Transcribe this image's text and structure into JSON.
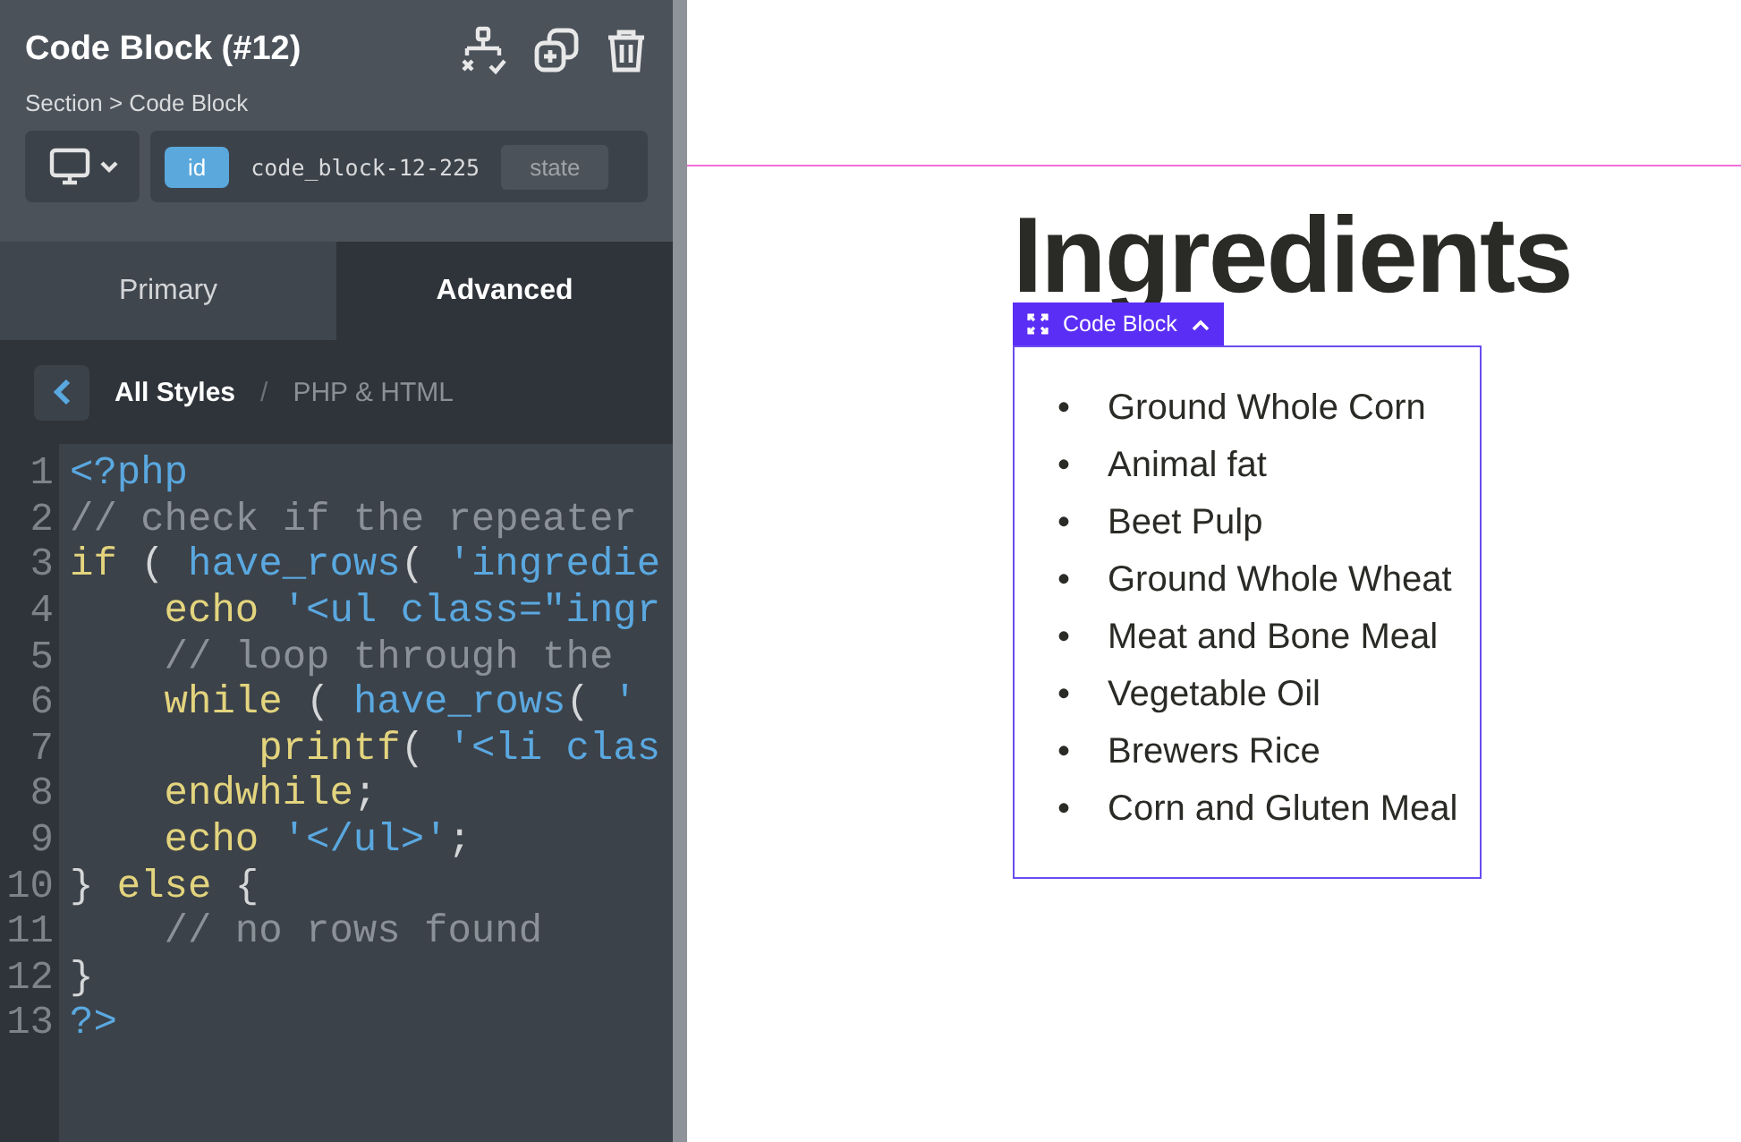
{
  "panel": {
    "title": "Code Block (#12)",
    "breadcrumb": "Section > Code Block",
    "selector": {
      "badge": "id",
      "value": "code_block-12-225",
      "state_button": "state"
    },
    "tabs": [
      {
        "label": "Primary",
        "selected": false
      },
      {
        "label": "Advanced",
        "selected": true
      }
    ],
    "style_path": {
      "current": "All Styles",
      "separator": "/",
      "section": "PHP & HTML"
    },
    "code_lines": [
      {
        "number": "1",
        "tokens": [
          {
            "kind": "tag",
            "text": "<?php"
          }
        ]
      },
      {
        "number": "2",
        "tokens": [
          {
            "kind": "comment",
            "text": "// check if the repeater"
          }
        ]
      },
      {
        "number": "3",
        "tokens": [
          {
            "kind": "keyword",
            "text": "if"
          },
          {
            "kind": "plain",
            "text": " ( "
          },
          {
            "kind": "function",
            "text": "have_rows"
          },
          {
            "kind": "plain",
            "text": "( "
          },
          {
            "kind": "string",
            "text": "'ingredie"
          }
        ]
      },
      {
        "number": "4",
        "tokens": [
          {
            "kind": "keyword",
            "text": "    echo"
          },
          {
            "kind": "string",
            "text": " '<ul class=\"ingr"
          }
        ]
      },
      {
        "number": "5",
        "tokens": [
          {
            "kind": "comment",
            "text": "    // loop through the"
          }
        ]
      },
      {
        "number": "6",
        "tokens": [
          {
            "kind": "keyword",
            "text": "    while"
          },
          {
            "kind": "plain",
            "text": " ( "
          },
          {
            "kind": "function",
            "text": "have_rows"
          },
          {
            "kind": "plain",
            "text": "( "
          },
          {
            "kind": "string",
            "text": "'"
          }
        ]
      },
      {
        "number": "7",
        "tokens": [
          {
            "kind": "keyword",
            "text": "        printf"
          },
          {
            "kind": "plain",
            "text": "( "
          },
          {
            "kind": "string",
            "text": "'<li clas"
          }
        ]
      },
      {
        "number": "8",
        "tokens": [
          {
            "kind": "keyword",
            "text": "    endwhile"
          },
          {
            "kind": "plain",
            "text": ";"
          }
        ]
      },
      {
        "number": "9",
        "tokens": [
          {
            "kind": "keyword",
            "text": "    echo"
          },
          {
            "kind": "string",
            "text": " '</ul>'"
          },
          {
            "kind": "plain",
            "text": ";"
          }
        ]
      },
      {
        "number": "10",
        "tokens": [
          {
            "kind": "plain",
            "text": "} "
          },
          {
            "kind": "keyword",
            "text": "else"
          },
          {
            "kind": "plain",
            "text": " {"
          }
        ]
      },
      {
        "number": "11",
        "tokens": [
          {
            "kind": "comment",
            "text": "    // no rows found"
          }
        ]
      },
      {
        "number": "12",
        "tokens": [
          {
            "kind": "plain",
            "text": "}"
          }
        ]
      },
      {
        "number": "13",
        "tokens": [
          {
            "kind": "tag",
            "text": "?>"
          }
        ]
      }
    ]
  },
  "canvas": {
    "heading": "Ingredients",
    "selection_label": "Code Block",
    "list": [
      {
        "marker": "•",
        "text": "Ground Whole Corn"
      },
      {
        "marker": "•",
        "text": "Animal fat"
      },
      {
        "marker": "•",
        "text": "Beet Pulp"
      },
      {
        "marker": "•",
        "text": "Ground Whole Wheat"
      },
      {
        "marker": "•",
        "text": "Meat and Bone Meal"
      },
      {
        "marker": "•",
        "text": "Vegetable Oil"
      },
      {
        "marker": "•",
        "text": "Brewers Rice"
      },
      {
        "marker": "•",
        "text": "Corn and Gluten Meal"
      }
    ]
  }
}
